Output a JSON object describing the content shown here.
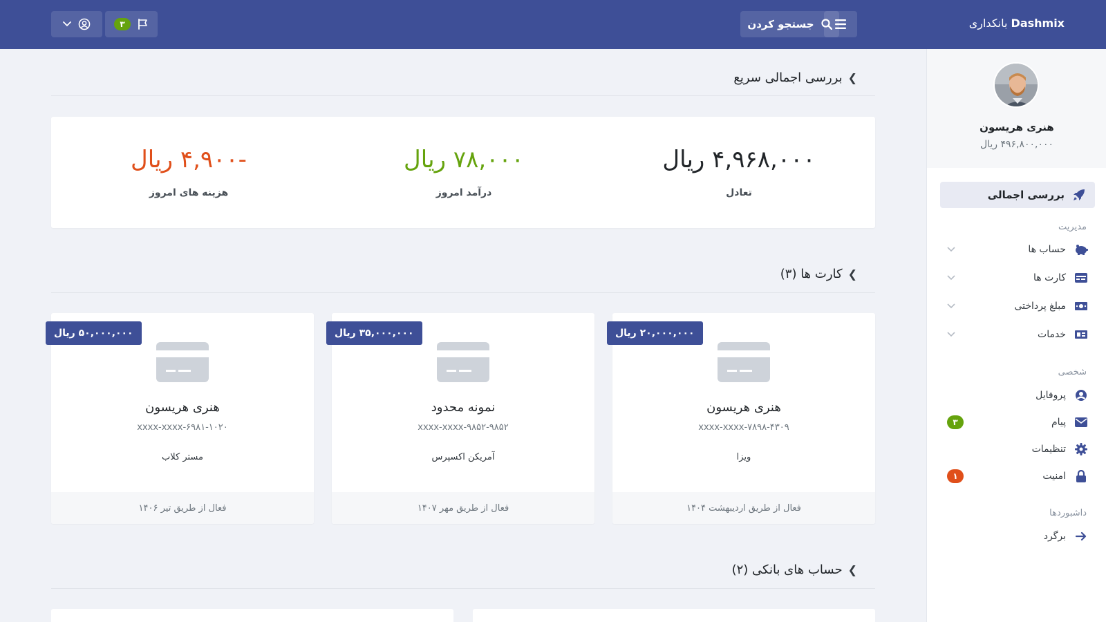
{
  "header": {
    "brand_name": "Dashmix",
    "brand_sub": "بانکداری",
    "search_label": "جستجو کردن",
    "notifications_count": "۳"
  },
  "sidebar": {
    "profile": {
      "name": "هنری هریسون",
      "balance": "۴۹۶,۸۰۰,۰۰۰ ریال"
    },
    "main_item": "بررسی اجمالی",
    "sections": {
      "management": "مدیریت",
      "personal": "شخصی",
      "dashboards": "داشبوردها"
    },
    "management_items": [
      {
        "label": "حساب ها",
        "icon": "piggy-bank-icon"
      },
      {
        "label": "کارت ها",
        "icon": "credit-card-icon"
      },
      {
        "label": "مبلغ پرداختی",
        "icon": "money-bill-icon"
      },
      {
        "label": "خدمات",
        "icon": "services-icon"
      }
    ],
    "personal_items": [
      {
        "label": "پروفایل",
        "icon": "user-circle-icon"
      },
      {
        "label": "پیام",
        "icon": "envelope-icon",
        "badge": "۳"
      },
      {
        "label": "تنظیمات",
        "icon": "gear-icon"
      },
      {
        "label": "امنیت",
        "icon": "lock-icon",
        "badge": "۱"
      }
    ],
    "dashboard_items": [
      {
        "label": "برگرد",
        "icon": "arrow-back-icon"
      }
    ]
  },
  "overview": {
    "title": "بررسی اجمالی سریع",
    "stats": [
      {
        "value": "۴,۹۶۸,۰۰۰ ریال",
        "label": "تعادل",
        "color": "#212529"
      },
      {
        "value": "۷۸,۰۰۰ ریال",
        "label": "درآمد امروز",
        "color": "#65a30d"
      },
      {
        "value": "-۴,۹۰۰ ریال",
        "label": "هزینه های امروز",
        "color": "#e04f1a"
      }
    ]
  },
  "cards": {
    "title": "کارت ها (۳)",
    "items": [
      {
        "limit": "۲۰,۰۰۰,۰۰۰ ریال",
        "name": "هنری هریسون",
        "number": "xxxx-xxxx-۷۸۹۸-۴۳۰۹",
        "type": "ویزا",
        "footer": "فعال از طریق اردیبهشت ۱۴۰۴"
      },
      {
        "limit": "۳۵,۰۰۰,۰۰۰ ریال",
        "name": "نمونه محدود",
        "number": "xxxx-xxxx-۹۸۵۲-۹۸۵۲",
        "type": "آمریکن اکسپرس",
        "footer": "فعال از طریق مهر ۱۴۰۷"
      },
      {
        "limit": "۵۰,۰۰۰,۰۰۰ ریال",
        "name": "هنری هریسون",
        "number": "xxxx-xxxx-۶۹۸۱-۱۰۲۰",
        "type": "مستر کلاب",
        "footer": "فعال از طریق تیر ۱۴۰۶"
      }
    ]
  },
  "accounts": {
    "title": "حساب های بانکی (۲)"
  },
  "colors": {
    "brand": "#3e4f97",
    "success": "#65a30d",
    "danger": "#e04f1a"
  }
}
